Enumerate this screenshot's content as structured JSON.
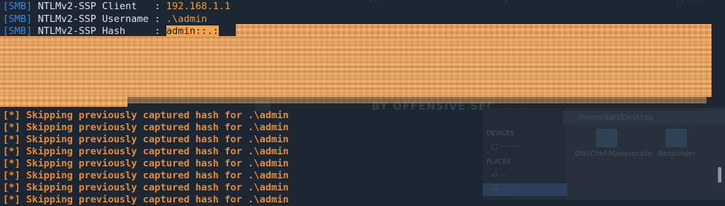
{
  "terminal": {
    "top_lines": [
      {
        "tag": "[SMB]",
        "label": " NTLMv2-SSP Client   : ",
        "value": "192.168.1.1"
      },
      {
        "tag": "[SMB]",
        "label": " NTLMv2-SSP Username : ",
        "value": ".\\admin"
      },
      {
        "tag": "[SMB]",
        "label": " NTLMv2-SSP Hash     : ",
        "value": "admin::.:"
      }
    ],
    "skip_lines": [
      "[*] Skipping previously captured hash for .\\admin",
      "[*] Skipping previously captured hash for .\\admin",
      "[*] Skipping previously captured hash for .\\admin",
      "[*] Skipping previously captured hash for .\\admin",
      "[*] Skipping previously captured hash for .\\admin",
      "[*] Skipping previously captured hash for .\\admin",
      "[*] Skipping previously captured hash for .\\admin",
      "[*] Skipping previously captured hash for .\\admin"
    ]
  },
  "background": {
    "watermark": "BY OFFENSIVE SEC",
    "path": "/home/kali/Desktop",
    "sidebar_devices_label": "DEVICES",
    "sidebar_places_label": "PLACES",
    "files": [
      "DNSChef-Masquerade",
      "Responder"
    ]
  },
  "colors": {
    "background": "#1d2633",
    "tag_blue": "#3f87d6",
    "value_orange": "#f39c3b",
    "skip_orange": "#ee8a2f",
    "redaction": "#e8a05a"
  }
}
